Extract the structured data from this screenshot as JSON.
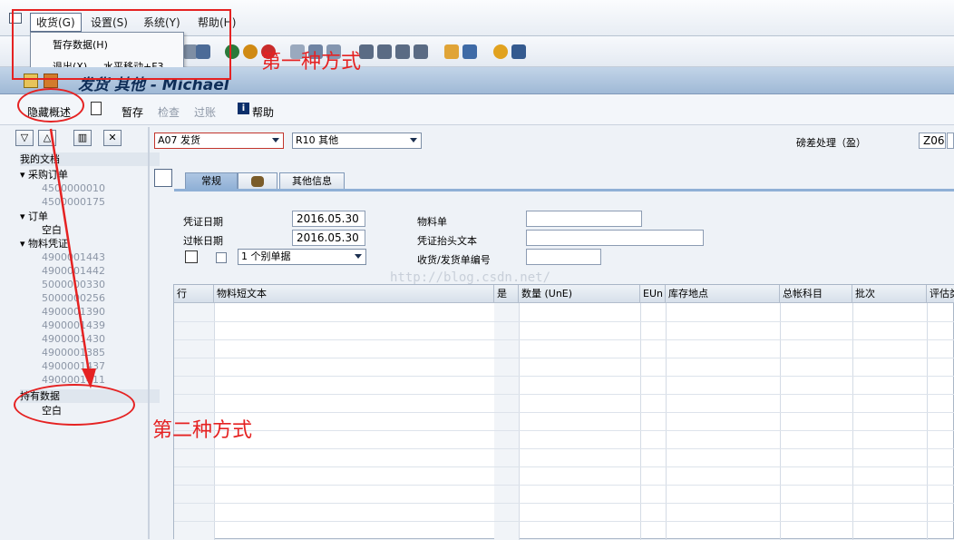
{
  "menubar": {
    "items": [
      "收货(G)",
      "设置(S)",
      "系统(Y)",
      "帮助(H)"
    ]
  },
  "dropdown_menu": {
    "items": [
      {
        "label": "暂存数据(H)",
        "shortcut": ""
      },
      {
        "label": "退出(X)",
        "shortcut": "水平移动+F3"
      }
    ]
  },
  "titlebar": {
    "title": "发货 其他 - Michael"
  },
  "apptoolbar": {
    "hide_overview": "隐藏概述",
    "hold": "暂存",
    "check": "检查",
    "post": "过账",
    "help": "帮助"
  },
  "left_panel": {
    "my_documents": "我的文档",
    "purchase_orders_label": "采购订单",
    "purchase_orders": [
      "4500000010",
      "4500000175"
    ],
    "orders_label": "订单",
    "orders": [
      "空白"
    ],
    "material_docs_label": "物料凭证",
    "material_docs": [
      "4900001443",
      "4900001442",
      "5000000330",
      "5000000256",
      "4900001390",
      "4900001439",
      "4900001430",
      "4900001385",
      "4900001437",
      "4900001411"
    ],
    "held_data_label": "持有数据",
    "held_data": [
      "空白"
    ]
  },
  "header": {
    "movement_type": "A07 发货",
    "ref_doc": "R10 其他",
    "diff_label": "磅差处理（盈）",
    "diff_value": "Z06"
  },
  "tabs": [
    "常规",
    "",
    "其他信息"
  ],
  "general": {
    "doc_date_label": "凭证日期",
    "doc_date": "2016.05.30",
    "post_date_label": "过帐日期",
    "post_date": "2016.05.30",
    "slip_select": "1 个别单据",
    "material_slip_label": "物料单",
    "header_text_label": "凭证抬头文本",
    "gr_gi_slip_label": "收货/发货单编号"
  },
  "watermark": "http://blog.csdn.net/",
  "grid": {
    "columns": [
      "行",
      "物料短文本",
      "是",
      "数量 (UnE)",
      "EUn",
      "库存地点",
      "总帐科目",
      "批次",
      "评估类"
    ]
  },
  "annotations": {
    "first_method": "第一种方式",
    "second_method": "第二种方式"
  },
  "colors": {
    "annotation": "#e52222",
    "title": "#0e2d57",
    "tab_active": "#8fb0d6"
  }
}
